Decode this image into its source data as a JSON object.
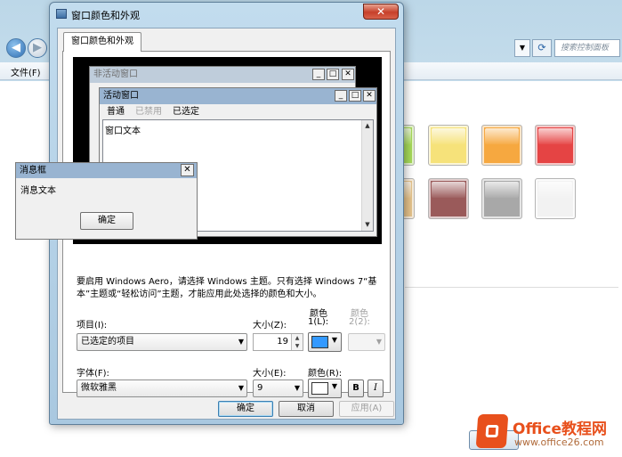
{
  "background_window": {
    "search_placeholder": "搜索控制面板",
    "menu_file": "文件(F)",
    "swatch_colors": [
      "#a8dc5a",
      "#f6e27a",
      "#f6a840",
      "#e54444",
      "#e7c48c",
      "#9a5a5a",
      "#a8a8a8",
      "#f2f2f2"
    ]
  },
  "dialog": {
    "title": "窗口颜色和外观",
    "close_glyph": "✕",
    "tab_label": "窗口颜色和外观",
    "preview": {
      "inactive_title": "非活动窗口",
      "active_title": "活动窗口",
      "menu_normal": "普通",
      "menu_disabled": "已禁用",
      "menu_selected": "已选定",
      "window_text": "窗口文本",
      "msgbox_title": "消息框",
      "msgbox_text": "消息文本",
      "msgbox_ok": "确定",
      "ctrl_min": "_",
      "ctrl_max": "□",
      "ctrl_close": "✕"
    },
    "info_text": "要启用 Windows Aero，请选择 Windows 主题。只有选择 Windows 7“基本”主题或“轻松访问”主题，才能应用此处选择的颜色和大小。",
    "labels": {
      "item": "项目(I):",
      "size1": "大小(Z):",
      "color1_line1": "颜色",
      "color1_line2": "1(L):",
      "color2_line1": "颜色",
      "color2_line2": "2(2):",
      "font": "字体(F):",
      "size2": "大小(E):",
      "color_r": "颜色(R):"
    },
    "fields": {
      "item_value": "已选定的项目",
      "size1_value": "19",
      "color1": "#3399ff",
      "font_value": "微软雅黑",
      "size2_value": "9",
      "color_r": "#ffffff",
      "bold": "B",
      "italic": "I"
    },
    "buttons": {
      "ok": "确定",
      "cancel": "取消",
      "apply": "应用(A)"
    }
  },
  "watermark": {
    "title": "Office教程网",
    "url": "www.office26.com"
  }
}
